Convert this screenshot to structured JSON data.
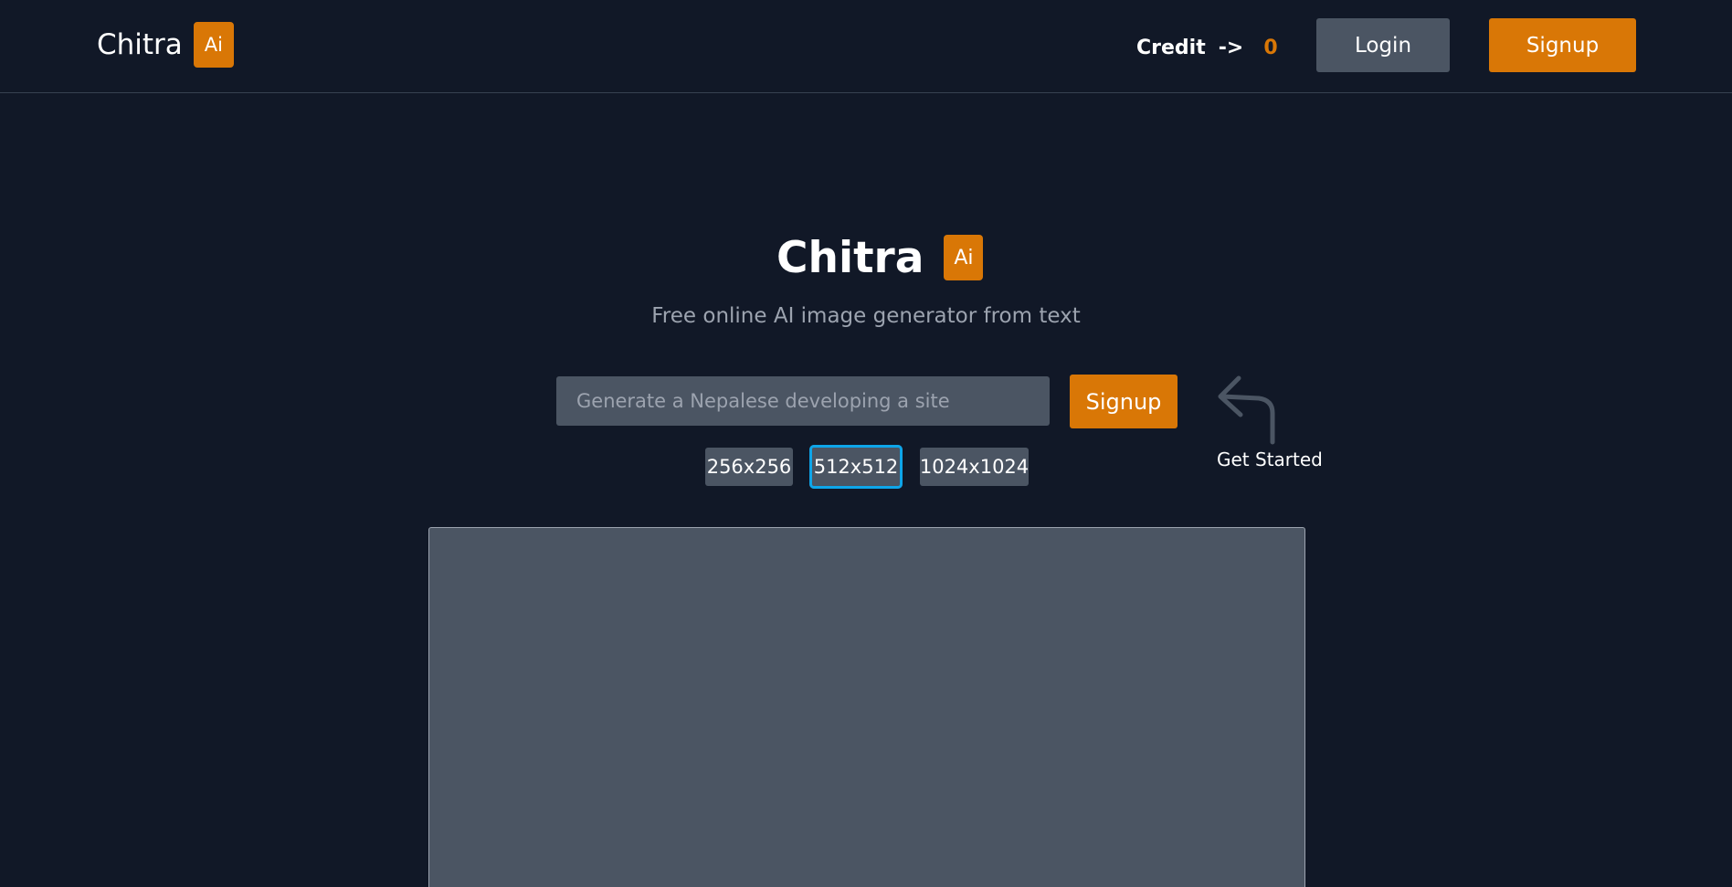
{
  "header": {
    "brand": {
      "name": "Chitra",
      "badge": "Ai"
    },
    "credit": {
      "label": "Credit",
      "arrow": "->",
      "value": "0"
    },
    "login_label": "Login",
    "signup_label": "Signup"
  },
  "hero": {
    "title": "Chitra",
    "badge": "Ai",
    "tagline": "Free online AI image generator from text"
  },
  "prompt": {
    "placeholder": "Generate a Nepalese developing a site",
    "value": "",
    "submit_label": "Signup"
  },
  "hint": {
    "icon": "curved-arrow-left-icon",
    "label": "Get Started"
  },
  "sizes": {
    "options": [
      "256x256",
      "512x512",
      "1024x1024"
    ],
    "selected": "512x512"
  },
  "colors": {
    "background": "#111827",
    "accent": "#d97706",
    "secondary_button": "#4b5563",
    "selected_outline": "#0ea5e9",
    "muted_text": "#9ca3af"
  }
}
